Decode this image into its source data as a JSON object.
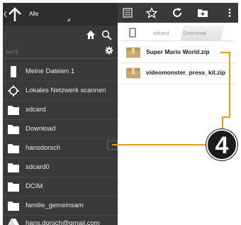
{
  "topbar": {
    "location_label": "Alle"
  },
  "drawer": {
    "section_title": "ORTE",
    "items": [
      {
        "label": "Meine Dateien 1",
        "icon": "phone-icon"
      },
      {
        "label": "Lokales Netzwerk scannen",
        "icon": "network-scan-icon"
      },
      {
        "label": "sdcard",
        "icon": "folder-icon"
      },
      {
        "label": "Download",
        "icon": "folder-icon"
      },
      {
        "label": "hansdorsch",
        "icon": "folder-icon"
      },
      {
        "label": "sdcard0",
        "icon": "folder-icon"
      },
      {
        "label": "DCIM",
        "icon": "folder-icon"
      },
      {
        "label": "familie_gemeinsam",
        "icon": "folder-icon"
      },
      {
        "label": "hans.dorsch@gmail.com",
        "icon": "google-drive-icon"
      }
    ]
  },
  "breadcrumb": {
    "parts": [
      "sdcard",
      "Download"
    ]
  },
  "files": [
    {
      "name": "Super Mario World.zip",
      "icon": "zip-archive-icon"
    },
    {
      "name": "videomonster_press_kit.zip",
      "icon": "zip-archive-icon"
    }
  ],
  "callout": {
    "number": "4",
    "color": "#e99a1c"
  }
}
